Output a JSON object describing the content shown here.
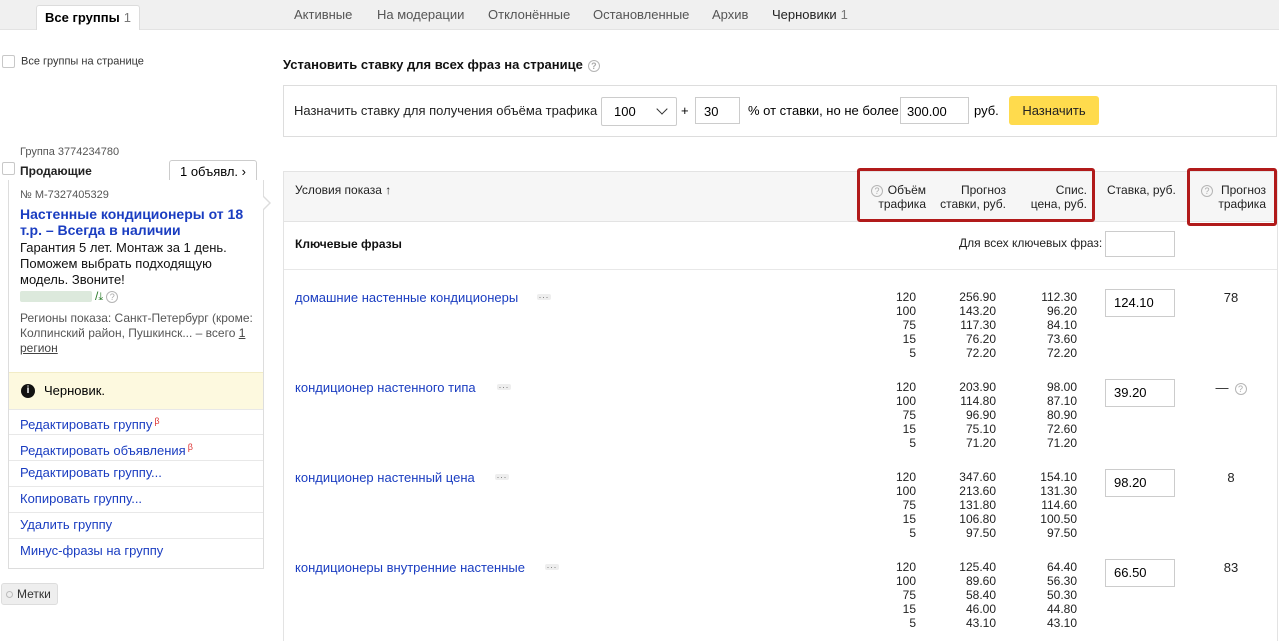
{
  "tabs": {
    "all": {
      "label": "Все группы",
      "count": "1"
    },
    "items": [
      {
        "label": "Активные"
      },
      {
        "label": "На модерации"
      },
      {
        "label": "Отклонённые"
      },
      {
        "label": "Остановленные"
      },
      {
        "label": "Архив"
      },
      {
        "label": "Черновики",
        "count": "1"
      }
    ]
  },
  "left": {
    "all_groups_label": "Все группы на странице",
    "group_id": "Группа 3774234780",
    "group_title": "Продающие",
    "ads_button": "1 объявл.",
    "ad": {
      "id": "№ M-7327405329",
      "title": "Настенные кондиционеры от 18 т.р. – Всегда в наличии",
      "text": "Гарантия 5 лет. Монтаж за 1 день. Поможем выбрать подходящую модель. Звоните!",
      "url_suffix": "/",
      "regions_text": "Регионы показа: Санкт-Петербург (кроме: Колпинский район, Пушкинск... – всего",
      "regions_link": "1 регион"
    },
    "draft_label": "Черновик.",
    "actions": [
      {
        "label": "Редактировать группу",
        "beta": "β"
      },
      {
        "label": "Редактировать объявления",
        "beta": "β"
      },
      {
        "label": "Редактировать группу...",
        "beta": ""
      },
      {
        "label": "Копировать группу...",
        "beta": ""
      },
      {
        "label": "Удалить группу",
        "beta": ""
      },
      {
        "label": "Минус-фразы на группу",
        "beta": ""
      }
    ],
    "tags_button": "Метки"
  },
  "setbid": {
    "title": "Установить ставку для всех фраз на странице",
    "label": "Назначить ставку для получения объёма трафика",
    "volume": "100",
    "plus": "+",
    "percent": "30",
    "percent_label": "% от ставки, но не более",
    "max_bid": "300.00",
    "currency": "руб.",
    "button": "Назначить"
  },
  "table": {
    "headers": {
      "conditions": "Условия показа ↑",
      "volume_1": "Объём",
      "volume_2": "трафика",
      "forecast_1": "Прогноз",
      "forecast_2": "ставки, руб.",
      "spis_1": "Спис.",
      "spis_2": "цена, руб.",
      "bid": "Ставка, руб.",
      "traffic_1": "Прогноз",
      "traffic_2": "трафика"
    },
    "keywords_heading": "Ключевые фразы",
    "for_all_label": "Для всех ключевых фраз:",
    "rows": [
      {
        "phrase": "домашние настенные кондиционеры",
        "volume": [
          "120",
          "100",
          "75",
          "15",
          "5"
        ],
        "forecast": [
          "256.90",
          "143.20",
          "117.30",
          "76.20",
          "72.20"
        ],
        "spis": [
          "112.30",
          "96.20",
          "84.10",
          "73.60",
          "72.20"
        ],
        "bid": "124.10",
        "traffic": "78"
      },
      {
        "phrase": "кондиционер настенного типа",
        "volume": [
          "120",
          "100",
          "75",
          "15",
          "5"
        ],
        "forecast": [
          "203.90",
          "114.80",
          "96.90",
          "75.10",
          "71.20"
        ],
        "spis": [
          "98.00",
          "87.10",
          "80.90",
          "72.60",
          "71.20"
        ],
        "bid": "39.20",
        "traffic": "—"
      },
      {
        "phrase": "кондиционер настенный цена",
        "volume": [
          "120",
          "100",
          "75",
          "15",
          "5"
        ],
        "forecast": [
          "347.60",
          "213.60",
          "131.80",
          "106.80",
          "97.50"
        ],
        "spis": [
          "154.10",
          "131.30",
          "114.60",
          "100.50",
          "97.50"
        ],
        "bid": "98.20",
        "traffic": "8"
      },
      {
        "phrase": "кондиционеры внутренние настенные",
        "volume": [
          "120",
          "100",
          "75",
          "15",
          "5"
        ],
        "forecast": [
          "125.40",
          "89.60",
          "58.40",
          "46.00",
          "43.10"
        ],
        "spis": [
          "64.40",
          "56.30",
          "50.30",
          "44.80",
          "43.10"
        ],
        "bid": "66.50",
        "traffic": "83"
      }
    ]
  },
  "colors": {
    "accent_link": "#1a3dc1",
    "highlight_border": "#b11a1a",
    "button_yellow": "#ffdb4d",
    "draft_bg": "#fdf9df"
  }
}
